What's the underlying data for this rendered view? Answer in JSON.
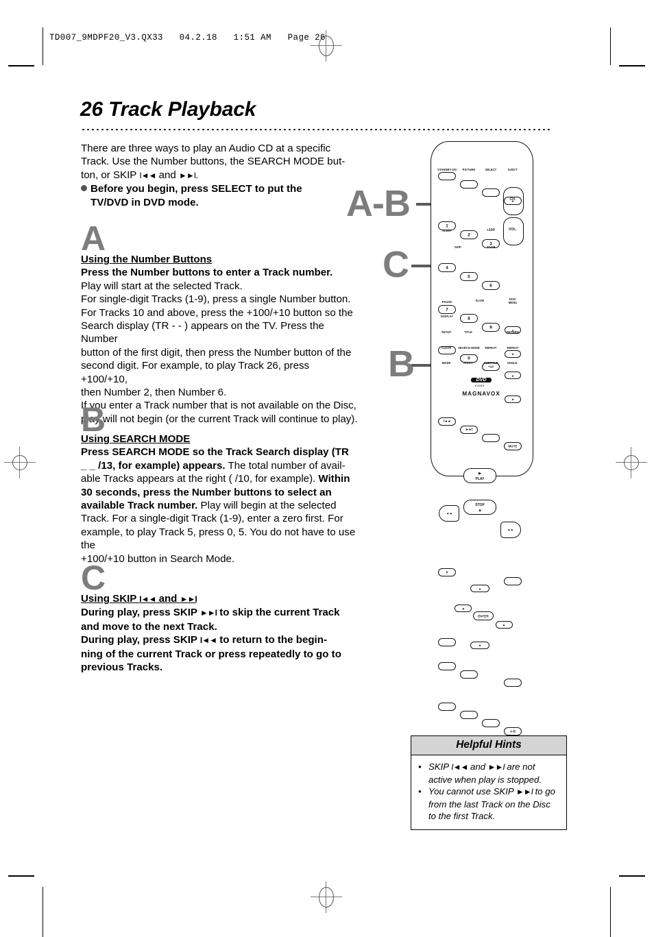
{
  "slug": "TD007_9MDPF20_V3.QX33   04.2.18   1:51 AM   Page 26",
  "title": "26  Track Playback",
  "intro": {
    "l1": "There are three ways to play an Audio CD at a specific",
    "l2": "Track.  Use the Number buttons, the SEARCH MODE but-",
    "l3a": "ton, or SKIP ",
    "l3b": "I◄◄",
    "l3c": " and ",
    "l3d": "►►I",
    "l3e": ".",
    "bullet1": "Before you begin, press SELECT to put the",
    "bullet2": "TV/DVD in DVD mode."
  },
  "sectionA": {
    "letter": "A",
    "heading": "Using the Number Buttons",
    "lead": "Press the Number buttons to enter a Track number.",
    "body": [
      "Play will start at the selected Track.",
      "For single-digit Tracks (1-9), press a single Number button.",
      "For Tracks 10 and above, press the +100/+10 button so the",
      "Search display (TR - - ) appears on the TV.  Press the Number",
      "button of the first digit, then press the Number button of the",
      "second digit.  For example, to play Track 26, press +100/+10,",
      "then Number 2, then Number 6.",
      "If you enter a Track number that is not available on the Disc,",
      "play will not begin (or the current Track will continue to play)."
    ]
  },
  "sectionB": {
    "letter": "B",
    "heading": "Using SEARCH MODE",
    "lead1": "Press SEARCH MODE so the Track Search display (TR",
    "lead2": "_ _ /13, for example) appears.",
    "mid1": " The total number of avail-",
    "mid2": "able Tracks appears at the right (  /10, for example). ",
    "bold2": "Within",
    "bold3": "30 seconds, press the Number buttons to select an",
    "bold4": "available Track number.",
    "tail1": " Play will begin at the selected",
    "tail2": "Track.  For a single-digit Track (1-9), enter a zero first. For",
    "tail3": "example, to play Track 5, press 0, 5. You do not have to use the",
    "tail4": "+100/+10 button in Search Mode."
  },
  "sectionC": {
    "letter": "C",
    "heading_a": "Using SKIP ",
    "heading_b": "I◄◄",
    "heading_c": " and ",
    "heading_d": "►►I",
    "l1a": "During play, press SKIP ",
    "l1b": "►►I",
    "l1c": " to skip the current Track",
    "l2": "and move to the next Track.",
    "l3a": "During play, press SKIP ",
    "l3b": "I◄◄",
    "l3c": " to return to the begin-",
    "l4": "ning of the current Track or press repeatedly to go to",
    "l5": "previous Tracks."
  },
  "callouts": {
    "ab": "A-B",
    "c": "C",
    "b": "B"
  },
  "hints": {
    "title": "Helpful Hints",
    "item1a": "SKIP ",
    "item1b": "I◄◄",
    "item1c": " and ",
    "item1d": "►►I",
    "item1e": " are not active when play is stopped.",
    "item2a": "You cannot use SKIP ",
    "item2b": "►►I",
    "item2c": " to go from the last Track on the Disc to the first Track."
  },
  "remote": {
    "brand": "MAGNAVOX",
    "dvd_logo": "DVD",
    "dvd_sub": "VIDEO",
    "row_top": [
      "STANDBY-ON",
      "PICTURE",
      "SELECT",
      "EJECT"
    ],
    "numbers": [
      "1",
      "2",
      "3",
      "4",
      "5",
      "6",
      "7",
      "8",
      "9",
      "0"
    ],
    "plus100": "+100",
    "plus10": "+10",
    "sleep": "SLEEP",
    "zoom": "ZOOM",
    "mute": "MUTE",
    "skip": "SKIP",
    "ch": "CH.",
    "vol": "VOL.",
    "play": "PLAY",
    "stop": "STOP",
    "slow": "SLOW",
    "pause": "PAUSE",
    "display": "DISPLAY",
    "setup": "SETUP",
    "title_btn": "TITLE",
    "return_btn": "RETURN",
    "disc_menu_1": "DISC",
    "disc_menu_2": "MENU",
    "enter": "ENTER",
    "clear": "CLEAR",
    "search_mode": "SEARCH MODE",
    "repeat": "REPEAT",
    "repeat_ab_label": "REPEAT",
    "repeat_ab_btn": "A-B",
    "mode": "MODE",
    "audio": "AUDIO",
    "subtitle": "SUBTITLE",
    "angle": "ANGLE",
    "up_arrow": "▲",
    "down_arrow": "▼",
    "left_arrow": "◄",
    "right_arrow": "►",
    "rew": "◄◄",
    "ffwd": "►►",
    "skip_back": "I◄◄",
    "skip_fwd": "►►I",
    "play_tri": "▶",
    "stop_sq": "■",
    "pause_bars": "II",
    "eject_tri": "▲"
  }
}
